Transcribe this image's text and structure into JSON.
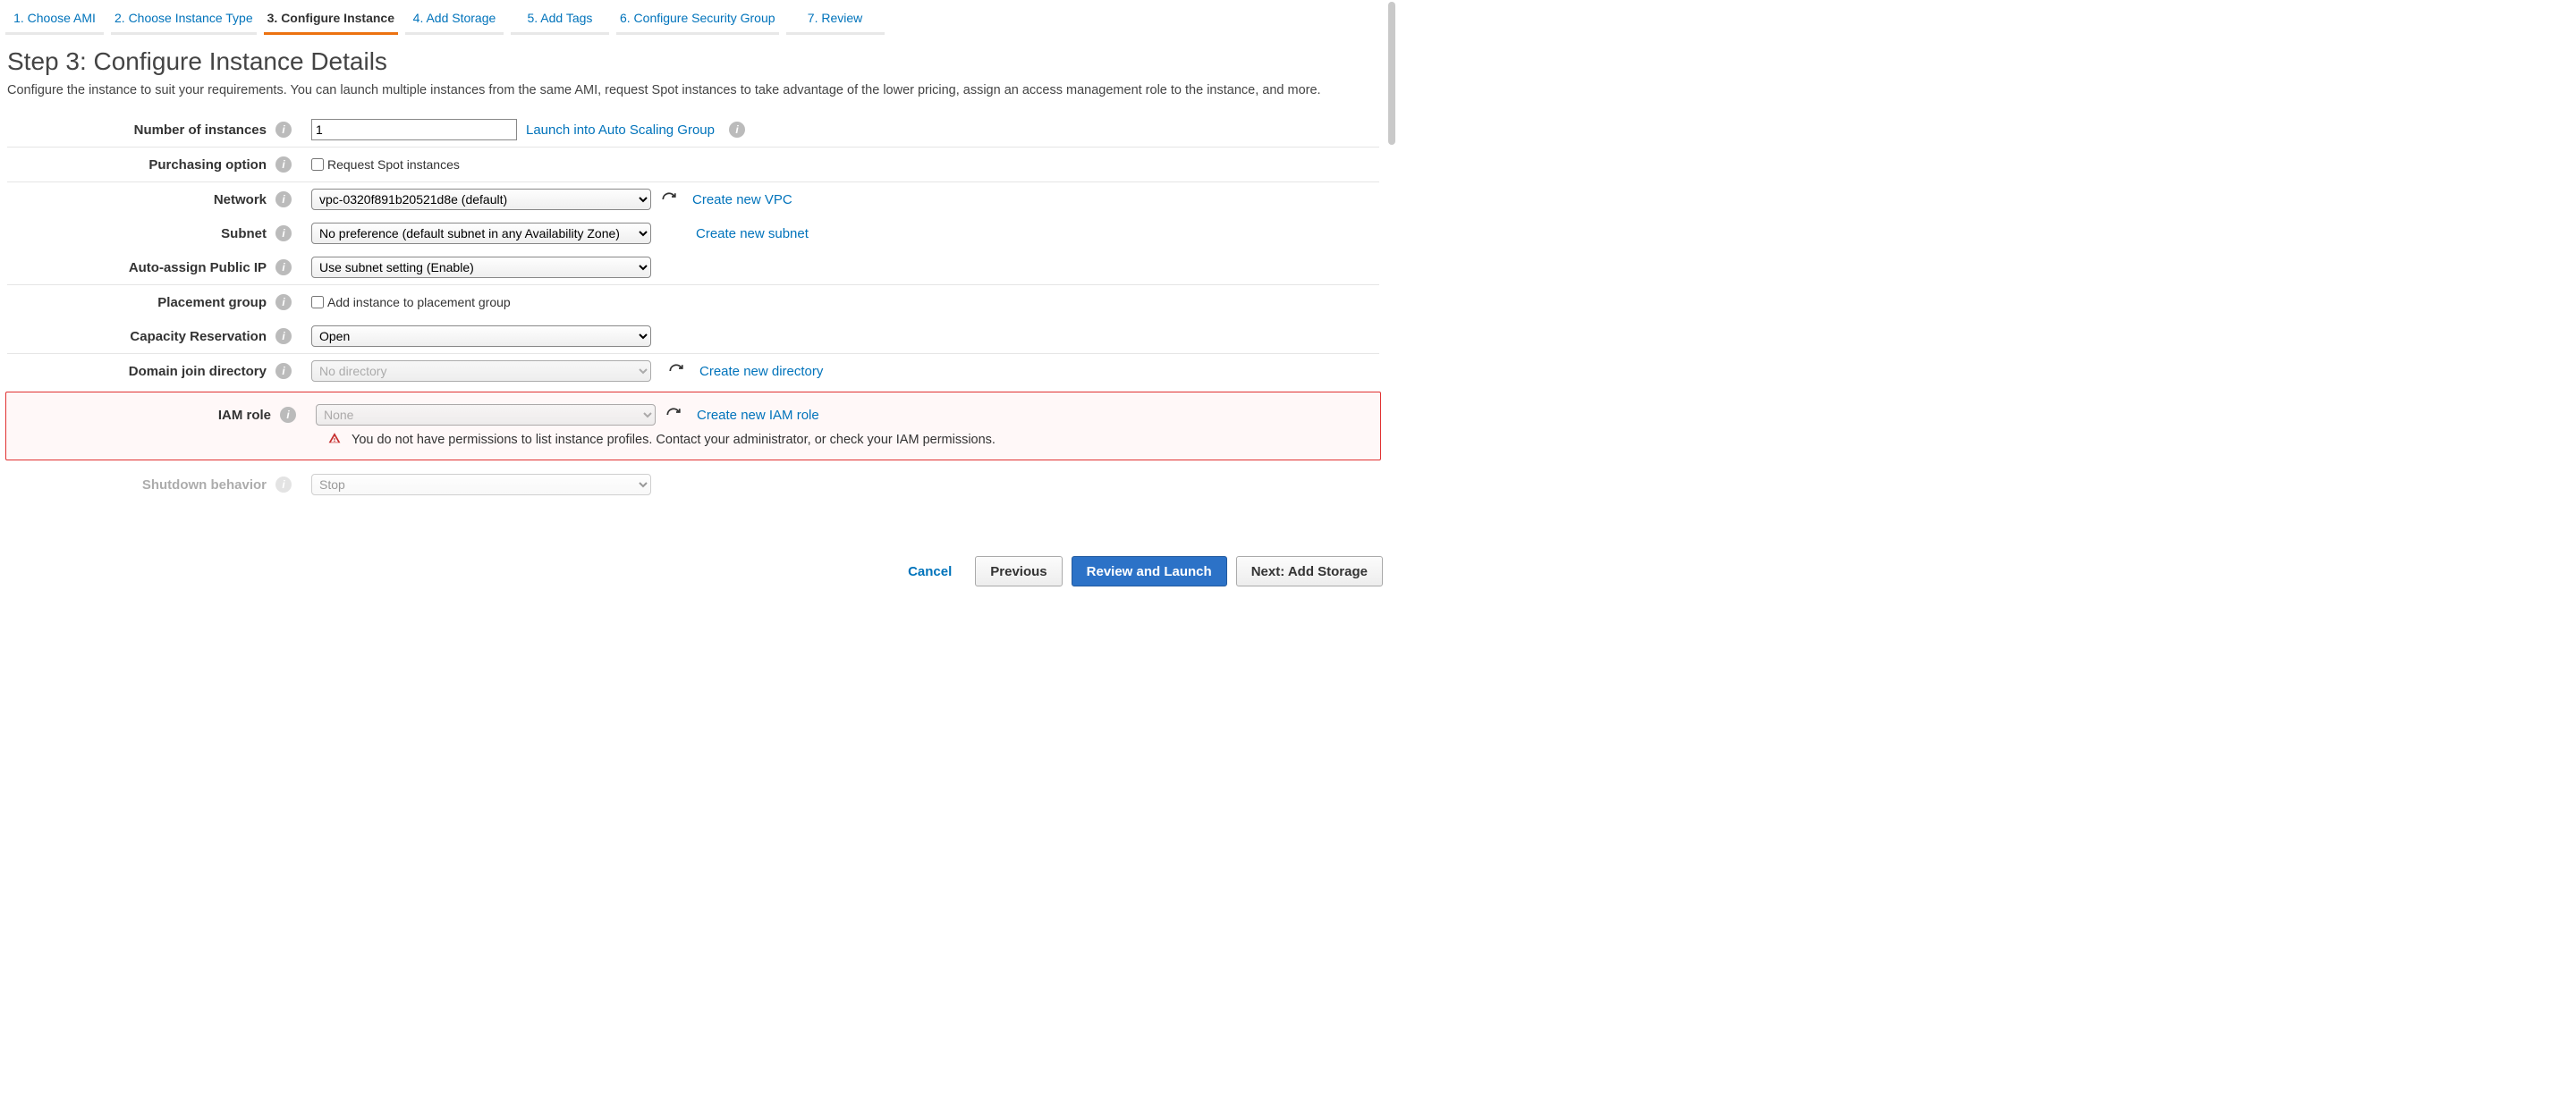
{
  "wizard": {
    "tabs": [
      {
        "label": "1. Choose AMI"
      },
      {
        "label": "2. Choose Instance Type"
      },
      {
        "label": "3. Configure Instance"
      },
      {
        "label": "4. Add Storage"
      },
      {
        "label": "5. Add Tags"
      },
      {
        "label": "6. Configure Security Group"
      },
      {
        "label": "7. Review"
      }
    ],
    "active_index": 2
  },
  "page": {
    "title": "Step 3: Configure Instance Details",
    "description": "Configure the instance to suit your requirements. You can launch multiple instances from the same AMI, request Spot instances to take advantage of the lower pricing, assign an access management role to the instance, and more."
  },
  "form": {
    "instances": {
      "label": "Number of instances",
      "value": "1",
      "launch_asg_link": "Launch into Auto Scaling Group"
    },
    "purchasing": {
      "label": "Purchasing option",
      "checkbox_label": "Request Spot instances",
      "checked": false
    },
    "network": {
      "label": "Network",
      "selected": "vpc-0320f891b20521d8e (default)",
      "create_link": "Create new VPC"
    },
    "subnet": {
      "label": "Subnet",
      "selected": "No preference (default subnet in any Availability Zone)",
      "create_link": "Create new subnet"
    },
    "autoip": {
      "label": "Auto-assign Public IP",
      "selected": "Use subnet setting (Enable)"
    },
    "placement": {
      "label": "Placement group",
      "checkbox_label": "Add instance to placement group",
      "checked": false
    },
    "capacity": {
      "label": "Capacity Reservation",
      "selected": "Open"
    },
    "domain": {
      "label": "Domain join directory",
      "selected": "No directory",
      "create_link": "Create new directory"
    },
    "iam": {
      "label": "IAM role",
      "selected": "None",
      "create_link": "Create new IAM role",
      "error_msg": "You do not have permissions to list instance profiles. Contact your administrator, or check your IAM permissions."
    },
    "shutdown": {
      "label": "Shutdown behavior",
      "selected": "Stop"
    }
  },
  "footer": {
    "cancel": "Cancel",
    "previous": "Previous",
    "review": "Review and Launch",
    "next": "Next: Add Storage"
  }
}
